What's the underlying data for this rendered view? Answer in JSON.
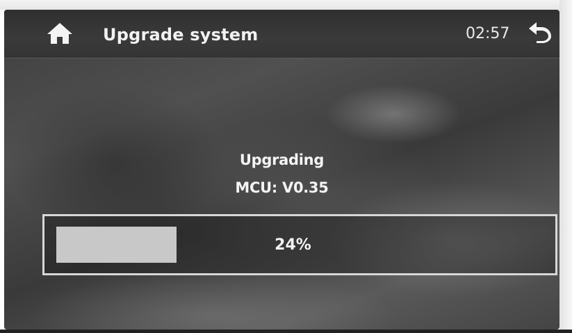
{
  "header": {
    "title": "Upgrade system",
    "time": "02:57",
    "home_icon": "home-icon",
    "back_icon": "back-arrow-icon"
  },
  "status": {
    "line1": "Upgrading",
    "line2": "MCU: V0.35"
  },
  "progress": {
    "value": 0.24,
    "label": "24%"
  },
  "colors": {
    "header_bg": "#333333",
    "text": "#f2f2f2",
    "progress_fill": "#c8c8c8",
    "progress_border": "#d7d7d7"
  }
}
